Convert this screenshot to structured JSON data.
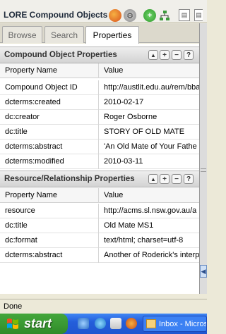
{
  "window": {
    "title": "LORE Compound Objects"
  },
  "tabs": [
    {
      "label": "Browse",
      "active": false
    },
    {
      "label": "Search",
      "active": false
    },
    {
      "label": "Properties",
      "active": true
    }
  ],
  "compound_panel": {
    "title": "Compound Object Properties",
    "columns": [
      "Property Name",
      "Value"
    ],
    "rows": [
      {
        "name": "Compound Object ID",
        "value": "http://austlit.edu.au/rem/bba"
      },
      {
        "name": "dcterms:created",
        "value": "2010-02-17"
      },
      {
        "name": "dc:creator",
        "value": "Roger Osborne"
      },
      {
        "name": "dc:title",
        "value": "STORY OF OLD MATE"
      },
      {
        "name": "dcterms:abstract",
        "value": "'An Old Mate of Your Fathe"
      },
      {
        "name": "dcterms:modified",
        "value": "2010-03-11"
      }
    ]
  },
  "resource_panel": {
    "title": "Resource/Relationship Properties",
    "columns": [
      "Property Name",
      "Value"
    ],
    "rows": [
      {
        "name": "resource",
        "value": "http://acms.sl.nsw.gov.au/a"
      },
      {
        "name": "dc:title",
        "value": "Old Mate MS1"
      },
      {
        "name": "dc:format",
        "value": "text/html; charset=utf-8"
      },
      {
        "name": "dcterms:abstract",
        "value": "Another of Roderick's interp"
      }
    ]
  },
  "panel_buttons": {
    "collapse": "▲",
    "add": "+",
    "remove": "−",
    "help": "?"
  },
  "status": {
    "text": "Done"
  },
  "taskbar": {
    "start_label": "start",
    "task_label": "Inbox - Micros"
  },
  "colors": {
    "accent": "#316ac5",
    "taskbar_blue": "#245edb",
    "start_green": "#3b9a33"
  },
  "icons": [
    "firefox-icon",
    "gear-icon",
    "add-icon",
    "tree-icon",
    "new-doc-icon",
    "copy-icon",
    "windows-flag-icon",
    "ie-icon",
    "outlook-icon"
  ]
}
